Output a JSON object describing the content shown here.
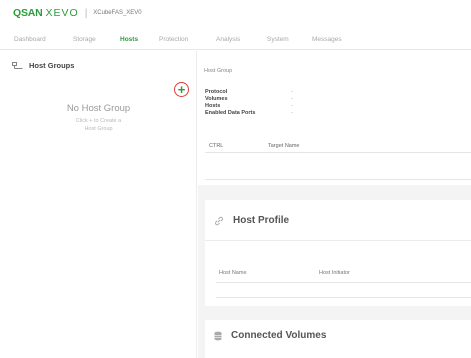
{
  "header": {
    "brand_primary": "QSAN",
    "brand_product": "XEVO",
    "device_name": "XCubeFAS_XEV0"
  },
  "nav": {
    "tabs": [
      {
        "label": "Dashboard"
      },
      {
        "label": "Storage"
      },
      {
        "label": "Hosts"
      },
      {
        "label": "Protection"
      },
      {
        "label": "Analysis"
      },
      {
        "label": "System"
      },
      {
        "label": "Messages"
      }
    ],
    "active": "Hosts"
  },
  "sidebar": {
    "title": "Host Groups",
    "add_icon": "plus-icon",
    "empty_title": "No Host Group",
    "empty_hint_line1": "Click + to Create a",
    "empty_hint_line2": "Host Group"
  },
  "host_group": {
    "section_label": "Host Group",
    "fields": [
      {
        "label": "Protocol",
        "value": "-"
      },
      {
        "label": "Volumes",
        "value": "-"
      },
      {
        "label": "Hosts",
        "value": "-"
      },
      {
        "label": "Enabled Data Ports",
        "value": "-"
      }
    ],
    "table_headers": [
      "CTRL",
      "Target Name"
    ]
  },
  "host_profile": {
    "title": "Host Profile",
    "icon": "link-icon",
    "table_headers": [
      "Host Name",
      "Host Initiator"
    ]
  },
  "connected_volumes": {
    "title": "Connected Volumes",
    "icon": "database-icon"
  },
  "colors": {
    "brand_green": "#2a9d3a",
    "highlight_red": "#e03a3a",
    "panel_bg": "#f4f4f4"
  }
}
